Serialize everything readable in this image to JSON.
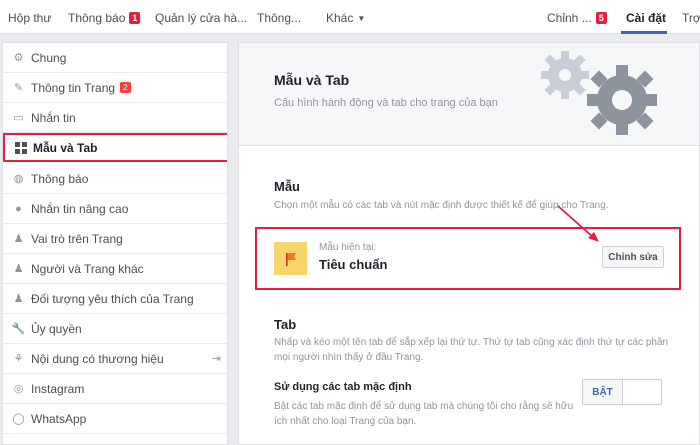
{
  "topnav": {
    "inbox": "Hộp thư",
    "notifications": "Thông báo",
    "notifications_count": "1",
    "page_manager": "Quản lý cửa hà...",
    "insights": "Thông...",
    "more": "Khác",
    "edit": "Chỉnh ...",
    "edit_count": "5",
    "settings": "Cài đặt",
    "help": "Trợ"
  },
  "sidebar": {
    "items": [
      {
        "label": "Chung",
        "icon": "gear-icon"
      },
      {
        "label": "Thông tin Trang",
        "icon": "pencil-icon",
        "badge": "2"
      },
      {
        "label": "Nhắn tin",
        "icon": "chat-icon"
      },
      {
        "label": "Mẫu và Tab",
        "icon": "grid-icon"
      },
      {
        "label": "Thông báo",
        "icon": "globe-icon"
      },
      {
        "label": "Nhắn tin nâng cao",
        "icon": "chat-bubble-icon"
      },
      {
        "label": "Vai trò trên Trang",
        "icon": "person-icon"
      },
      {
        "label": "Người và Trang khác",
        "icon": "people-icon"
      },
      {
        "label": "Đối tượng yêu thích của Trang",
        "icon": "people-star-icon"
      },
      {
        "label": "Ủy quyền",
        "icon": "wrench-icon"
      },
      {
        "label": "Nội dung có thương hiệu",
        "icon": "handshake-icon"
      },
      {
        "label": "Instagram",
        "icon": "instagram-icon"
      },
      {
        "label": "WhatsApp",
        "icon": "whatsapp-icon"
      }
    ]
  },
  "main": {
    "title": "Mẫu và Tab",
    "subtitle": "Cấu hình hành động và tab cho trang của bạn",
    "templates": {
      "title": "Mẫu",
      "desc": "Chọn một mẫu có các tab và nút mặc định được thiết kế để giúp cho Trang.",
      "current_label": "Mẫu hiện tại:",
      "current_name": "Tiêu chuẩn",
      "edit_button": "Chỉnh sửa"
    },
    "tabs": {
      "title": "Tab",
      "desc": "Nhấp và kéo một tên tab để sắp xếp lại thứ tự. Thứ tự tab cũng xác định thứ tự các phần mọi người nhìn thấy ở đầu Trang.",
      "default_label": "Sử dụng các tab mặc định",
      "default_desc": "Bật các tab mặc định để sử dụng tab mà chúng tôi cho rằng sẽ hữu ích nhất cho loại Trang của bạn.",
      "toggle_on": "BẬT"
    }
  },
  "colors": {
    "accent": "#4267b2",
    "highlight": "#e41e3f",
    "template_icon_bg": "#f7d56b"
  }
}
